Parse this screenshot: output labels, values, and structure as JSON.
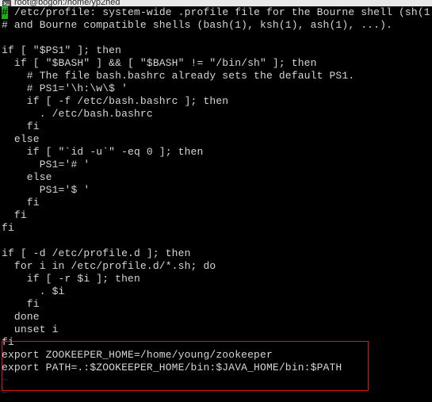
{
  "window": {
    "title": "root@bogon:/home/yp2hed",
    "icon": "terminal-icon"
  },
  "terminal": {
    "background_color": "#000000",
    "text_color": "#d6d6d6",
    "cursor_color": "#1faa1f",
    "tilde_color": "#1b2f8a",
    "highlight_box_color": "#e01616",
    "cursor_char": "#",
    "lines": [
      {
        "id": "l01",
        "text": " /etc/profile: system-wide .profile file for the Bourne shell (sh(1",
        "cursor": true
      },
      {
        "id": "l02",
        "text": "# and Bourne compatible shells (bash(1), ksh(1), ash(1), ...)."
      },
      {
        "id": "l03",
        "text": "",
        "blank": true
      },
      {
        "id": "l04",
        "text": "if [ \"$PS1\" ]; then"
      },
      {
        "id": "l05",
        "text": "  if [ \"$BASH\" ] && [ \"$BASH\" != \"/bin/sh\" ]; then"
      },
      {
        "id": "l06",
        "text": "    # The file bash.bashrc already sets the default PS1."
      },
      {
        "id": "l07",
        "text": "    # PS1='\\h:\\w\\$ '"
      },
      {
        "id": "l08",
        "text": "    if [ -f /etc/bash.bashrc ]; then"
      },
      {
        "id": "l09",
        "text": "      . /etc/bash.bashrc"
      },
      {
        "id": "l10",
        "text": "    fi"
      },
      {
        "id": "l11",
        "text": "  else"
      },
      {
        "id": "l12",
        "text": "    if [ \"`id -u`\" -eq 0 ]; then"
      },
      {
        "id": "l13",
        "text": "      PS1='# '"
      },
      {
        "id": "l14",
        "text": "    else"
      },
      {
        "id": "l15",
        "text": "      PS1='$ '"
      },
      {
        "id": "l16",
        "text": "    fi"
      },
      {
        "id": "l17",
        "text": "  fi"
      },
      {
        "id": "l18",
        "text": "fi"
      },
      {
        "id": "l19",
        "text": "",
        "blank": true
      },
      {
        "id": "l20",
        "text": "if [ -d /etc/profile.d ]; then"
      },
      {
        "id": "l21",
        "text": "  for i in /etc/profile.d/*.sh; do"
      },
      {
        "id": "l22",
        "text": "    if [ -r $i ]; then"
      },
      {
        "id": "l23",
        "text": "      . $i"
      },
      {
        "id": "l24",
        "text": "    fi"
      },
      {
        "id": "l25",
        "text": "  done"
      },
      {
        "id": "l26",
        "text": "  unset i"
      },
      {
        "id": "l27",
        "text": "fi"
      },
      {
        "id": "l28",
        "text": "export ZOOKEEPER_HOME=/home/young/zookeeper"
      },
      {
        "id": "l29",
        "text": "export PATH=.:$ZOOKEEPER_HOME/bin:$JAVA_HOME/bin:$PATH"
      },
      {
        "id": "l30",
        "text": "~",
        "tilde": true
      },
      {
        "id": "l31",
        "text": "~",
        "tilde": true
      }
    ],
    "highlight": {
      "label": "zookeeper-path-export-highlight",
      "covers_lines": [
        "l27",
        "l28",
        "l29",
        "l30"
      ]
    }
  }
}
